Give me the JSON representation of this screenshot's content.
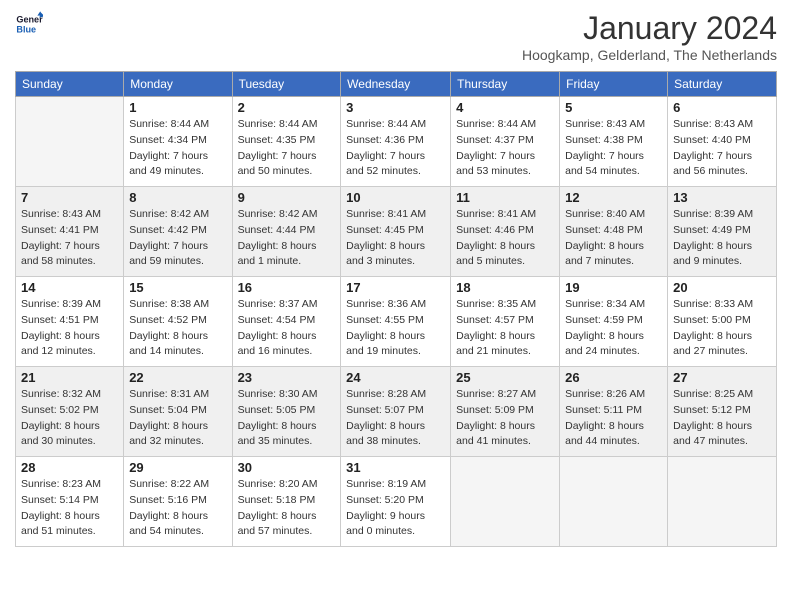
{
  "header": {
    "logo_text_general": "General",
    "logo_text_blue": "Blue",
    "month_title": "January 2024",
    "location": "Hoogkamp, Gelderland, The Netherlands"
  },
  "weekdays": [
    "Sunday",
    "Monday",
    "Tuesday",
    "Wednesday",
    "Thursday",
    "Friday",
    "Saturday"
  ],
  "weeks": [
    [
      {
        "day": "",
        "sunrise": "",
        "sunset": "",
        "daylight": "",
        "empty": true
      },
      {
        "day": "1",
        "sunrise": "8:44 AM",
        "sunset": "4:34 PM",
        "daylight": "7 hours and 49 minutes."
      },
      {
        "day": "2",
        "sunrise": "8:44 AM",
        "sunset": "4:35 PM",
        "daylight": "7 hours and 50 minutes."
      },
      {
        "day": "3",
        "sunrise": "8:44 AM",
        "sunset": "4:36 PM",
        "daylight": "7 hours and 52 minutes."
      },
      {
        "day": "4",
        "sunrise": "8:44 AM",
        "sunset": "4:37 PM",
        "daylight": "7 hours and 53 minutes."
      },
      {
        "day": "5",
        "sunrise": "8:43 AM",
        "sunset": "4:38 PM",
        "daylight": "7 hours and 54 minutes."
      },
      {
        "day": "6",
        "sunrise": "8:43 AM",
        "sunset": "4:40 PM",
        "daylight": "7 hours and 56 minutes."
      }
    ],
    [
      {
        "day": "7",
        "sunrise": "8:43 AM",
        "sunset": "4:41 PM",
        "daylight": "7 hours and 58 minutes."
      },
      {
        "day": "8",
        "sunrise": "8:42 AM",
        "sunset": "4:42 PM",
        "daylight": "7 hours and 59 minutes."
      },
      {
        "day": "9",
        "sunrise": "8:42 AM",
        "sunset": "4:44 PM",
        "daylight": "8 hours and 1 minute."
      },
      {
        "day": "10",
        "sunrise": "8:41 AM",
        "sunset": "4:45 PM",
        "daylight": "8 hours and 3 minutes."
      },
      {
        "day": "11",
        "sunrise": "8:41 AM",
        "sunset": "4:46 PM",
        "daylight": "8 hours and 5 minutes."
      },
      {
        "day": "12",
        "sunrise": "8:40 AM",
        "sunset": "4:48 PM",
        "daylight": "8 hours and 7 minutes."
      },
      {
        "day": "13",
        "sunrise": "8:39 AM",
        "sunset": "4:49 PM",
        "daylight": "8 hours and 9 minutes."
      }
    ],
    [
      {
        "day": "14",
        "sunrise": "8:39 AM",
        "sunset": "4:51 PM",
        "daylight": "8 hours and 12 minutes."
      },
      {
        "day": "15",
        "sunrise": "8:38 AM",
        "sunset": "4:52 PM",
        "daylight": "8 hours and 14 minutes."
      },
      {
        "day": "16",
        "sunrise": "8:37 AM",
        "sunset": "4:54 PM",
        "daylight": "8 hours and 16 minutes."
      },
      {
        "day": "17",
        "sunrise": "8:36 AM",
        "sunset": "4:55 PM",
        "daylight": "8 hours and 19 minutes."
      },
      {
        "day": "18",
        "sunrise": "8:35 AM",
        "sunset": "4:57 PM",
        "daylight": "8 hours and 21 minutes."
      },
      {
        "day": "19",
        "sunrise": "8:34 AM",
        "sunset": "4:59 PM",
        "daylight": "8 hours and 24 minutes."
      },
      {
        "day": "20",
        "sunrise": "8:33 AM",
        "sunset": "5:00 PM",
        "daylight": "8 hours and 27 minutes."
      }
    ],
    [
      {
        "day": "21",
        "sunrise": "8:32 AM",
        "sunset": "5:02 PM",
        "daylight": "8 hours and 30 minutes."
      },
      {
        "day": "22",
        "sunrise": "8:31 AM",
        "sunset": "5:04 PM",
        "daylight": "8 hours and 32 minutes."
      },
      {
        "day": "23",
        "sunrise": "8:30 AM",
        "sunset": "5:05 PM",
        "daylight": "8 hours and 35 minutes."
      },
      {
        "day": "24",
        "sunrise": "8:28 AM",
        "sunset": "5:07 PM",
        "daylight": "8 hours and 38 minutes."
      },
      {
        "day": "25",
        "sunrise": "8:27 AM",
        "sunset": "5:09 PM",
        "daylight": "8 hours and 41 minutes."
      },
      {
        "day": "26",
        "sunrise": "8:26 AM",
        "sunset": "5:11 PM",
        "daylight": "8 hours and 44 minutes."
      },
      {
        "day": "27",
        "sunrise": "8:25 AM",
        "sunset": "5:12 PM",
        "daylight": "8 hours and 47 minutes."
      }
    ],
    [
      {
        "day": "28",
        "sunrise": "8:23 AM",
        "sunset": "5:14 PM",
        "daylight": "8 hours and 51 minutes."
      },
      {
        "day": "29",
        "sunrise": "8:22 AM",
        "sunset": "5:16 PM",
        "daylight": "8 hours and 54 minutes."
      },
      {
        "day": "30",
        "sunrise": "8:20 AM",
        "sunset": "5:18 PM",
        "daylight": "8 hours and 57 minutes."
      },
      {
        "day": "31",
        "sunrise": "8:19 AM",
        "sunset": "5:20 PM",
        "daylight": "9 hours and 0 minutes."
      },
      {
        "day": "",
        "sunrise": "",
        "sunset": "",
        "daylight": "",
        "empty": true
      },
      {
        "day": "",
        "sunrise": "",
        "sunset": "",
        "daylight": "",
        "empty": true
      },
      {
        "day": "",
        "sunrise": "",
        "sunset": "",
        "daylight": "",
        "empty": true
      }
    ]
  ],
  "labels": {
    "sunrise": "Sunrise:",
    "sunset": "Sunset:",
    "daylight": "Daylight:"
  }
}
